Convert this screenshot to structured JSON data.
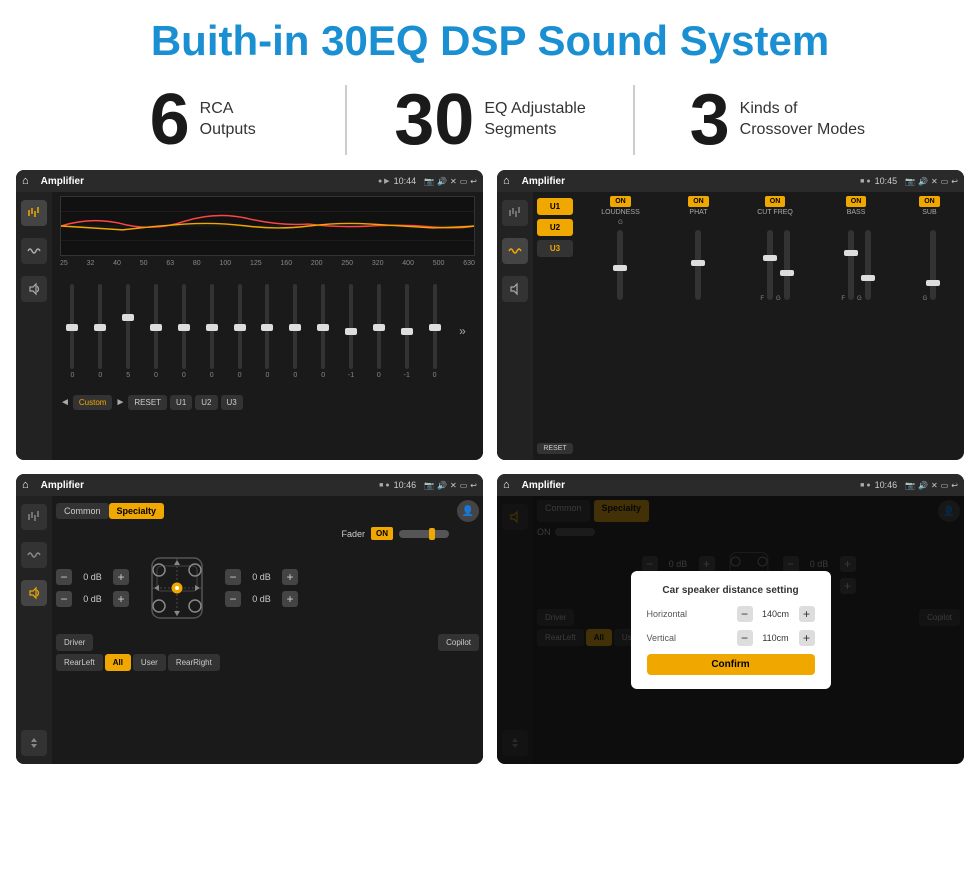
{
  "page": {
    "title": "Buith-in 30EQ DSP Sound System",
    "stats": [
      {
        "number": "6",
        "label": "RCA\nOutputs"
      },
      {
        "number": "30",
        "label": "EQ Adjustable\nSegments"
      },
      {
        "number": "3",
        "label": "Kinds of\nCrossover Modes"
      }
    ],
    "screens": [
      {
        "id": "screen1",
        "statusBar": {
          "appName": "Amplifier",
          "time": "10:44"
        },
        "type": "eq"
      },
      {
        "id": "screen2",
        "statusBar": {
          "appName": "Amplifier",
          "time": "10:45"
        },
        "type": "amp2"
      },
      {
        "id": "screen3",
        "statusBar": {
          "appName": "Amplifier",
          "time": "10:46"
        },
        "type": "specialty"
      },
      {
        "id": "screen4",
        "statusBar": {
          "appName": "Amplifier",
          "time": "10:46"
        },
        "type": "dialog"
      }
    ],
    "dialog": {
      "title": "Car speaker distance setting",
      "horizontal_label": "Horizontal",
      "horizontal_value": "140cm",
      "vertical_label": "Vertical",
      "vertical_value": "110cm",
      "confirm_label": "Confirm"
    },
    "eq_frequencies": [
      "25",
      "32",
      "40",
      "50",
      "63",
      "80",
      "100",
      "125",
      "160",
      "200",
      "250",
      "320",
      "400",
      "500",
      "630"
    ],
    "eq_values": [
      "0",
      "0",
      "0",
      "5",
      "0",
      "0",
      "0",
      "0",
      "0",
      "0",
      "0",
      "-1",
      "0",
      "-1"
    ],
    "eq_modes": [
      {
        "label": "Custom"
      },
      {
        "label": "RESET"
      },
      {
        "label": "U1"
      },
      {
        "label": "U2"
      },
      {
        "label": "U3"
      }
    ],
    "presets": [
      "U1",
      "U2",
      "U3"
    ],
    "channels": [
      {
        "name": "LOUDNESS",
        "on": true
      },
      {
        "name": "PHAT",
        "on": true
      },
      {
        "name": "CUT FREQ",
        "on": true
      },
      {
        "name": "BASS",
        "on": true
      },
      {
        "name": "SUB",
        "on": true
      }
    ],
    "tabs": [
      {
        "label": "Common",
        "active": false
      },
      {
        "label": "Specialty",
        "active": true
      }
    ],
    "bottom_buttons": [
      {
        "label": "Driver",
        "active": false
      },
      {
        "label": "RearLeft",
        "active": false
      },
      {
        "label": "All",
        "active": true
      },
      {
        "label": "User",
        "active": false
      },
      {
        "label": "Copilot",
        "active": false
      },
      {
        "label": "RearRight",
        "active": false
      }
    ],
    "fader_label": "Fader",
    "icons": {
      "home": "⌂",
      "pin": "📍",
      "camera": "📷",
      "volume": "🔊",
      "close": "✕",
      "window": "▭",
      "back": "↩",
      "dots": "●●",
      "equalizer": "≡",
      "wave": "〜",
      "speaker": "🔈",
      "user": "👤",
      "minus": "−",
      "plus": "+"
    }
  }
}
